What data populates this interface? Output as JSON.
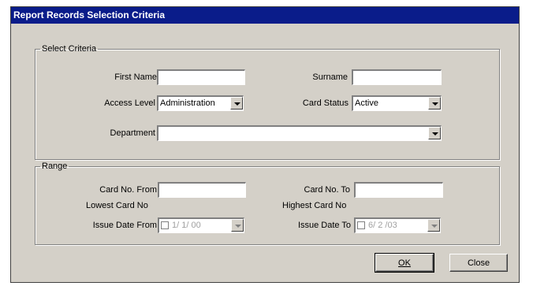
{
  "window": {
    "title": "Report Records Selection Criteria"
  },
  "criteria": {
    "legend": "Select Criteria",
    "first_name_label": "First Name",
    "first_name_value": "",
    "surname_label": "Surname",
    "surname_value": "",
    "access_level_label": "Access Level",
    "access_level_value": "Administration",
    "card_status_label": "Card Status",
    "card_status_value": "Active",
    "department_label": "Department",
    "department_value": ""
  },
  "range": {
    "legend": "Range",
    "card_from_label": "Card No. From",
    "card_from_value": "",
    "card_from_hint": "Lowest Card No",
    "card_to_label": "Card No. To",
    "card_to_value": "",
    "card_to_hint": "Highest Card No",
    "issue_from_label": "Issue Date From",
    "issue_from_value": "1/ 1/ 00",
    "issue_to_label": "Issue Date To",
    "issue_to_value": "6/ 2 /03"
  },
  "buttons": {
    "ok_label": "OK",
    "close_label": "Close"
  },
  "icons": {
    "dropdown": "chevron-down-icon",
    "checkbox": "checkbox-icon"
  }
}
